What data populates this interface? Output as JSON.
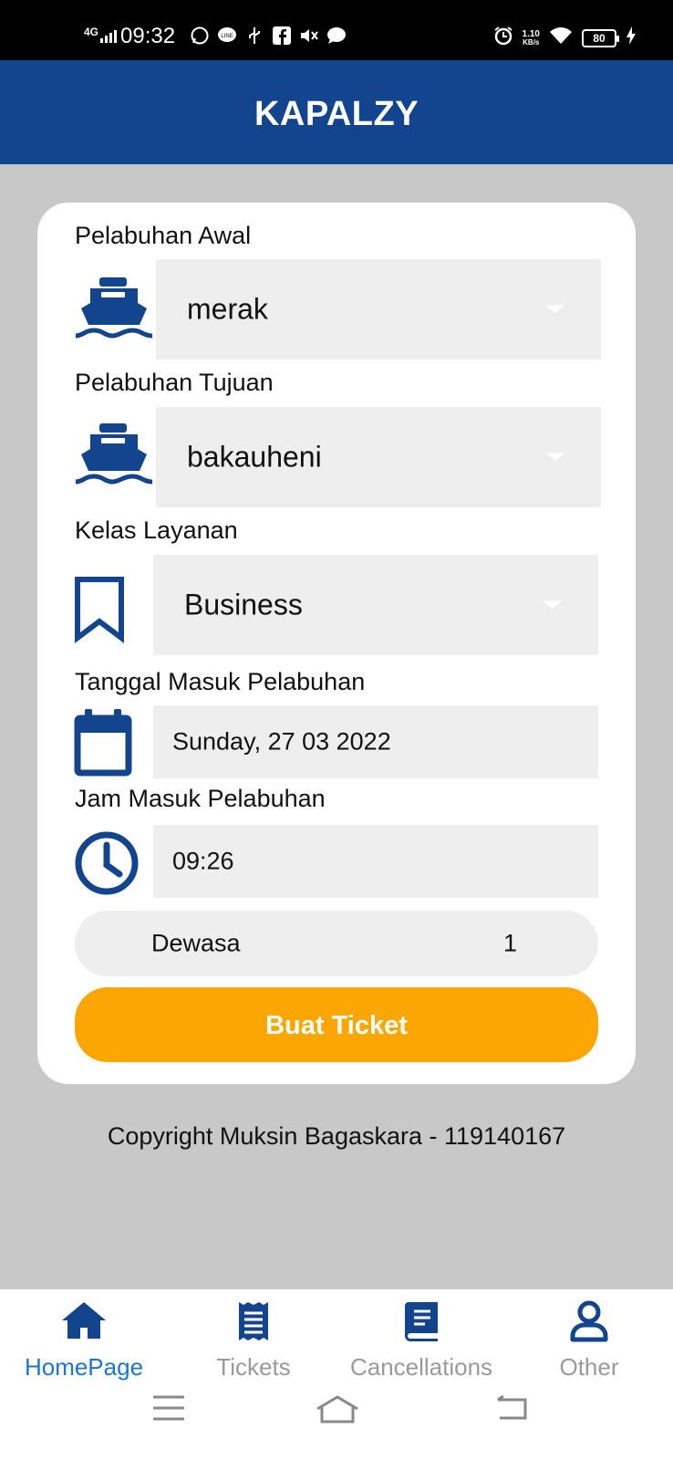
{
  "status_bar": {
    "network": "4G",
    "time": "09:32",
    "speed_value": "1.10",
    "speed_unit": "KB/s",
    "battery": "80"
  },
  "app": {
    "title": "KAPALZY"
  },
  "form": {
    "origin": {
      "label": "Pelabuhan Awal",
      "value": "merak",
      "icon": "ship-icon"
    },
    "destination": {
      "label": "Pelabuhan Tujuan",
      "value": "bakauheni",
      "icon": "ship-icon"
    },
    "service_class": {
      "label": "Kelas Layanan",
      "value": "Business",
      "icon": "bookmark-icon"
    },
    "date": {
      "label": "Tanggal Masuk Pelabuhan",
      "value": "Sunday, 27 03 2022",
      "icon": "calendar-icon"
    },
    "time": {
      "label": "Jam Masuk Pelabuhan",
      "value": "09:26",
      "icon": "clock-icon"
    },
    "passenger": {
      "label": "Dewasa",
      "count": "1"
    },
    "submit_label": "Buat Ticket"
  },
  "footer": {
    "copyright": "Copyright Muksin Bagaskara - 119140167"
  },
  "bottom_nav": {
    "items": [
      {
        "label": "HomePage",
        "icon": "home-icon",
        "active": true
      },
      {
        "label": "Tickets",
        "icon": "receipt-icon",
        "active": false
      },
      {
        "label": "Cancellations",
        "icon": "book-icon",
        "active": false
      },
      {
        "label": "Other",
        "icon": "user-icon",
        "active": false
      }
    ]
  },
  "colors": {
    "primary": "#13458e",
    "accent": "#fba602",
    "active_nav": "#1976d2",
    "background": "#c9c8c9"
  }
}
